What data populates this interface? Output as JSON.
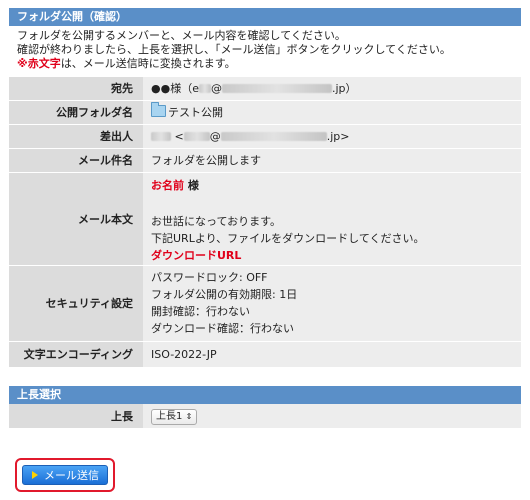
{
  "header": {
    "title": "フォルダ公開（確認）"
  },
  "intro": {
    "line1": "フォルダを公開するメンバーと、メール内容を確認してください。",
    "line2": "確認が終わりましたら、上長を選択し、「メール送信」ボタンをクリックしてください。",
    "line3_prefix": "※",
    "line3_red": "赤文字",
    "line3_suffix": "は、メール送信時に変換されます。"
  },
  "rows": {
    "recipient_label": "宛先",
    "recipient_prefix": "●●様（e",
    "recipient_at": "@",
    "recipient_suffix": ".jp）",
    "folder_label": "公開フォルダ名",
    "folder_name": "テスト公開",
    "sender_label": "差出人",
    "sender_prefix": "<",
    "sender_at": "@",
    "sender_suffix": ".jp>",
    "subject_label": "メール件名",
    "subject_value": "フォルダを公開します",
    "body_label": "メール本文",
    "body_name": "お名前",
    "body_sama": " 様",
    "body_line1": "お世話になっております。",
    "body_line2": "下記URLより、ファイルをダウンロードしてください。",
    "body_url": "ダウンロードURL",
    "security_label": "セキュリティ設定",
    "security_line1": "パスワードロック: OFF",
    "security_line2": "フォルダ公開の有効期限: 1日",
    "security_line3": "開封確認：行わない",
    "security_line4": "ダウンロード確認：行わない",
    "encoding_label": "文字エンコーディング",
    "encoding_value": "ISO-2022-JP"
  },
  "approver": {
    "section_title": "上長選択",
    "label": "上長",
    "selected": "上長1"
  },
  "submit": {
    "label": "メール送信"
  }
}
